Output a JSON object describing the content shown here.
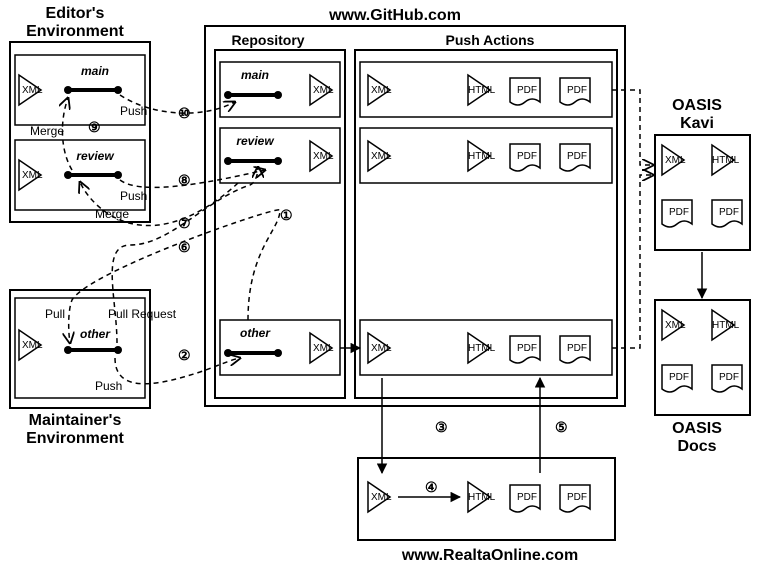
{
  "titles": {
    "editor_env": "Editor's\nEnvironment",
    "maintainer_env": "Maintainer's\nEnvironment",
    "github": "www.GitHub.com",
    "repository": "Repository",
    "push_actions": "Push Actions",
    "oasis_kavi": "OASIS\nKavi",
    "oasis_docs": "OASIS\nDocs",
    "realta": "www.RealtaOnline.com"
  },
  "branches": {
    "editor_main": "main",
    "editor_review": "review",
    "maint_other": "other",
    "repo_main": "main",
    "repo_review": "review",
    "repo_other": "other"
  },
  "labels": {
    "xml": "XML",
    "html": "HTML",
    "pdf": "PDF",
    "push": "Push",
    "merge": "Merge",
    "pull": "Pull",
    "pull_request": "Pull Request"
  },
  "steps": {
    "s1": "①",
    "s2": "②",
    "s3": "③",
    "s4": "④",
    "s5": "⑤",
    "s6": "⑥",
    "s7": "⑦",
    "s8": "⑧",
    "s9": "⑨",
    "s10": "⑩"
  },
  "chart_data": {
    "type": "diagram",
    "nodes": [
      {
        "id": "editor_env",
        "label": "Editor's Environment",
        "contains": [
          "editor_main_branch",
          "editor_review_branch"
        ]
      },
      {
        "id": "maintainer_env",
        "label": "Maintainer's Environment",
        "contains": [
          "maint_other_branch"
        ]
      },
      {
        "id": "github",
        "label": "www.GitHub.com",
        "contains": [
          "repository",
          "push_actions"
        ]
      },
      {
        "id": "repository",
        "label": "Repository",
        "contains": [
          "repo_main_branch",
          "repo_review_branch",
          "repo_other_branch"
        ]
      },
      {
        "id": "push_actions",
        "label": "Push Actions",
        "contains": [
          "pa_main",
          "pa_review",
          "pa_other"
        ]
      },
      {
        "id": "pa_main",
        "outputs": [
          "XML",
          "HTML",
          "PDF",
          "PDF"
        ]
      },
      {
        "id": "pa_review",
        "outputs": [
          "XML",
          "HTML",
          "PDF",
          "PDF"
        ]
      },
      {
        "id": "pa_other",
        "outputs": [
          "XML",
          "HTML",
          "PDF",
          "PDF"
        ]
      },
      {
        "id": "oasis_kavi",
        "label": "OASIS Kavi",
        "files": [
          "XML",
          "HTML",
          "PDF",
          "PDF"
        ]
      },
      {
        "id": "oasis_docs",
        "label": "OASIS Docs",
        "files": [
          "XML",
          "HTML",
          "PDF",
          "PDF"
        ]
      },
      {
        "id": "realta",
        "label": "www.RealtaOnline.com",
        "files": [
          "XML",
          "HTML",
          "PDF",
          "PDF"
        ]
      }
    ],
    "edges": [
      {
        "step": 1,
        "from": "repo_other_branch",
        "to": "maint_other_branch",
        "label": "Pull"
      },
      {
        "step": 2,
        "from": "maint_other_branch",
        "to": "repo_other_branch",
        "label": "Push"
      },
      {
        "step": 3,
        "from": "pa_other.XML",
        "to": "realta.XML"
      },
      {
        "step": 4,
        "from": "realta.XML",
        "to": "realta.HTML/PDF"
      },
      {
        "step": 5,
        "from": "realta.HTML/PDF",
        "to": "pa_other.HTML/PDF"
      },
      {
        "step": 6,
        "from": "maint_other_branch",
        "to": "repo_review_branch",
        "label": "Pull Request"
      },
      {
        "step": 7,
        "from": "repo_review_branch",
        "to": "editor_review_branch",
        "label": "Merge"
      },
      {
        "step": 8,
        "from": "editor_review_branch",
        "to": "repo_review_branch",
        "label": "Push"
      },
      {
        "step": 9,
        "from": "editor_review_branch",
        "to": "editor_main_branch",
        "label": "Merge"
      },
      {
        "step": 10,
        "from": "editor_main_branch",
        "to": "repo_main_branch",
        "label": "Push"
      },
      {
        "from": "pa_main",
        "to": "oasis_kavi",
        "style": "dashed"
      },
      {
        "from": "pa_other",
        "to": "oasis_kavi",
        "style": "dashed"
      },
      {
        "from": "oasis_kavi",
        "to": "oasis_docs",
        "style": "solid"
      }
    ]
  }
}
